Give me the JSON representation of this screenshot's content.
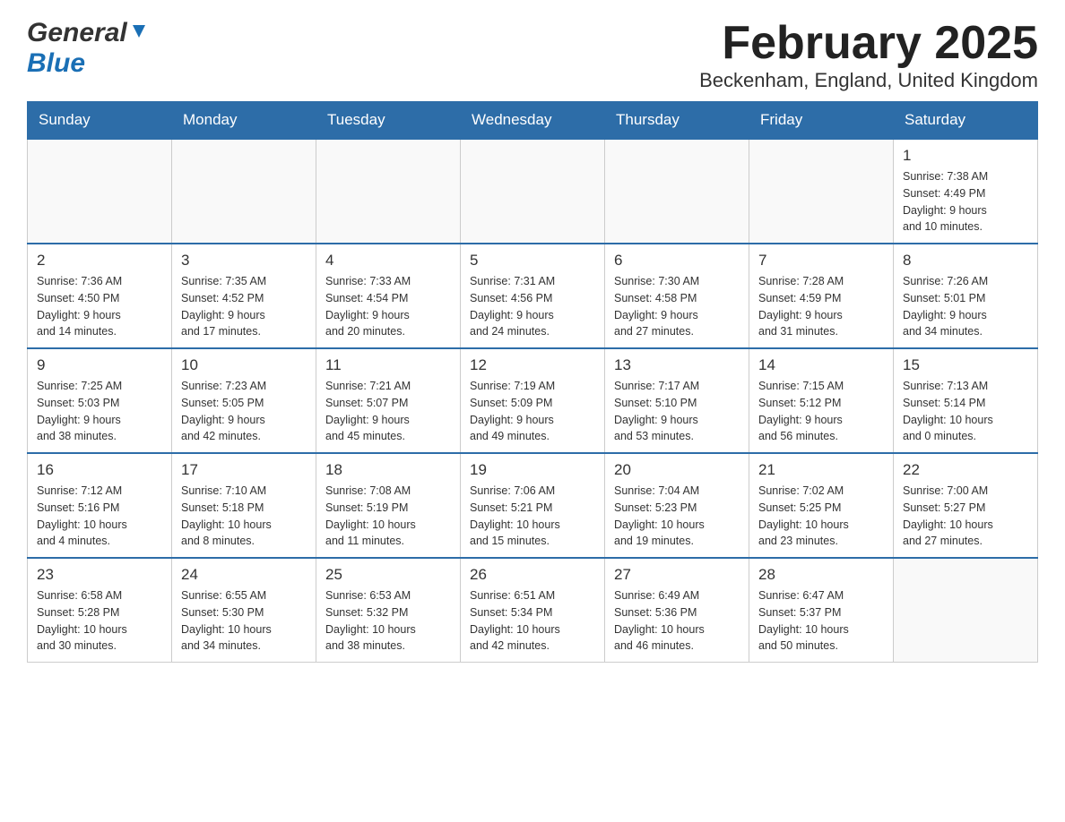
{
  "logo": {
    "general": "General",
    "blue": "Blue"
  },
  "title": "February 2025",
  "subtitle": "Beckenham, England, United Kingdom",
  "days_of_week": [
    "Sunday",
    "Monday",
    "Tuesday",
    "Wednesday",
    "Thursday",
    "Friday",
    "Saturday"
  ],
  "weeks": [
    [
      {
        "day": "",
        "info": ""
      },
      {
        "day": "",
        "info": ""
      },
      {
        "day": "",
        "info": ""
      },
      {
        "day": "",
        "info": ""
      },
      {
        "day": "",
        "info": ""
      },
      {
        "day": "",
        "info": ""
      },
      {
        "day": "1",
        "info": "Sunrise: 7:38 AM\nSunset: 4:49 PM\nDaylight: 9 hours\nand 10 minutes."
      }
    ],
    [
      {
        "day": "2",
        "info": "Sunrise: 7:36 AM\nSunset: 4:50 PM\nDaylight: 9 hours\nand 14 minutes."
      },
      {
        "day": "3",
        "info": "Sunrise: 7:35 AM\nSunset: 4:52 PM\nDaylight: 9 hours\nand 17 minutes."
      },
      {
        "day": "4",
        "info": "Sunrise: 7:33 AM\nSunset: 4:54 PM\nDaylight: 9 hours\nand 20 minutes."
      },
      {
        "day": "5",
        "info": "Sunrise: 7:31 AM\nSunset: 4:56 PM\nDaylight: 9 hours\nand 24 minutes."
      },
      {
        "day": "6",
        "info": "Sunrise: 7:30 AM\nSunset: 4:58 PM\nDaylight: 9 hours\nand 27 minutes."
      },
      {
        "day": "7",
        "info": "Sunrise: 7:28 AM\nSunset: 4:59 PM\nDaylight: 9 hours\nand 31 minutes."
      },
      {
        "day": "8",
        "info": "Sunrise: 7:26 AM\nSunset: 5:01 PM\nDaylight: 9 hours\nand 34 minutes."
      }
    ],
    [
      {
        "day": "9",
        "info": "Sunrise: 7:25 AM\nSunset: 5:03 PM\nDaylight: 9 hours\nand 38 minutes."
      },
      {
        "day": "10",
        "info": "Sunrise: 7:23 AM\nSunset: 5:05 PM\nDaylight: 9 hours\nand 42 minutes."
      },
      {
        "day": "11",
        "info": "Sunrise: 7:21 AM\nSunset: 5:07 PM\nDaylight: 9 hours\nand 45 minutes."
      },
      {
        "day": "12",
        "info": "Sunrise: 7:19 AM\nSunset: 5:09 PM\nDaylight: 9 hours\nand 49 minutes."
      },
      {
        "day": "13",
        "info": "Sunrise: 7:17 AM\nSunset: 5:10 PM\nDaylight: 9 hours\nand 53 minutes."
      },
      {
        "day": "14",
        "info": "Sunrise: 7:15 AM\nSunset: 5:12 PM\nDaylight: 9 hours\nand 56 minutes."
      },
      {
        "day": "15",
        "info": "Sunrise: 7:13 AM\nSunset: 5:14 PM\nDaylight: 10 hours\nand 0 minutes."
      }
    ],
    [
      {
        "day": "16",
        "info": "Sunrise: 7:12 AM\nSunset: 5:16 PM\nDaylight: 10 hours\nand 4 minutes."
      },
      {
        "day": "17",
        "info": "Sunrise: 7:10 AM\nSunset: 5:18 PM\nDaylight: 10 hours\nand 8 minutes."
      },
      {
        "day": "18",
        "info": "Sunrise: 7:08 AM\nSunset: 5:19 PM\nDaylight: 10 hours\nand 11 minutes."
      },
      {
        "day": "19",
        "info": "Sunrise: 7:06 AM\nSunset: 5:21 PM\nDaylight: 10 hours\nand 15 minutes."
      },
      {
        "day": "20",
        "info": "Sunrise: 7:04 AM\nSunset: 5:23 PM\nDaylight: 10 hours\nand 19 minutes."
      },
      {
        "day": "21",
        "info": "Sunrise: 7:02 AM\nSunset: 5:25 PM\nDaylight: 10 hours\nand 23 minutes."
      },
      {
        "day": "22",
        "info": "Sunrise: 7:00 AM\nSunset: 5:27 PM\nDaylight: 10 hours\nand 27 minutes."
      }
    ],
    [
      {
        "day": "23",
        "info": "Sunrise: 6:58 AM\nSunset: 5:28 PM\nDaylight: 10 hours\nand 30 minutes."
      },
      {
        "day": "24",
        "info": "Sunrise: 6:55 AM\nSunset: 5:30 PM\nDaylight: 10 hours\nand 34 minutes."
      },
      {
        "day": "25",
        "info": "Sunrise: 6:53 AM\nSunset: 5:32 PM\nDaylight: 10 hours\nand 38 minutes."
      },
      {
        "day": "26",
        "info": "Sunrise: 6:51 AM\nSunset: 5:34 PM\nDaylight: 10 hours\nand 42 minutes."
      },
      {
        "day": "27",
        "info": "Sunrise: 6:49 AM\nSunset: 5:36 PM\nDaylight: 10 hours\nand 46 minutes."
      },
      {
        "day": "28",
        "info": "Sunrise: 6:47 AM\nSunset: 5:37 PM\nDaylight: 10 hours\nand 50 minutes."
      },
      {
        "day": "",
        "info": ""
      }
    ]
  ]
}
